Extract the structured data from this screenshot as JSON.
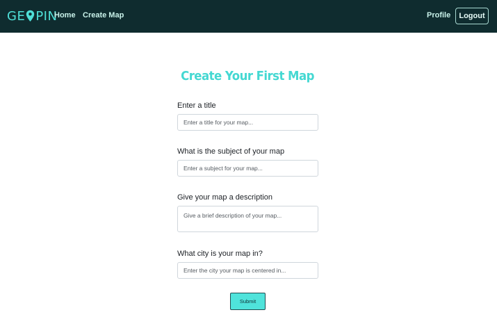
{
  "nav": {
    "logo_left": "GE",
    "logo_right": "PIN",
    "home": "Home",
    "create_map": "Create Map",
    "profile": "Profile",
    "logout": "Logout"
  },
  "form": {
    "heading": "Create Your First Map",
    "title_label": "Enter a title",
    "title_placeholder": "Enter a title for your map...",
    "subject_label": "What is the subject of your map",
    "subject_placeholder": "Enter a subject for your map...",
    "description_label": "Give your map a description",
    "description_placeholder": "Give a brief description of your map...",
    "city_label": "What city is your map in?",
    "city_placeholder": "Enter the city your map is centered in...",
    "submit": "Submit"
  },
  "colors": {
    "navbar_bg": "#0f2c2f",
    "accent": "#4fe3db",
    "heading": "#45d8d2"
  },
  "icons": {
    "logo_pin": "map-pin-icon"
  }
}
